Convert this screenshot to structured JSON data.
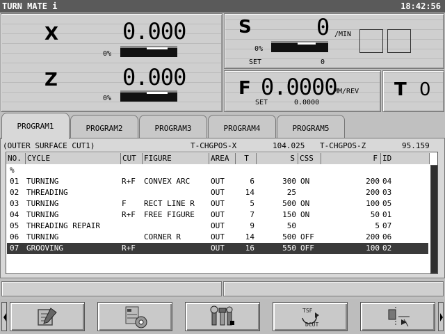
{
  "title_bar": {
    "app_name": "TURN MATE i",
    "clock": "18:42:56"
  },
  "axes": {
    "x": {
      "letter": "X",
      "value": "0.000",
      "percent": "0%"
    },
    "z": {
      "letter": "Z",
      "value": "0.000",
      "percent": "0%"
    }
  },
  "spindle": {
    "letter": "S",
    "value": "0",
    "unit": "/MIN",
    "percent": "0%",
    "set_label": "SET",
    "set_value": "0"
  },
  "feed": {
    "letter": "F",
    "value": "0.0000",
    "unit": "MM/REV",
    "set_label": "SET",
    "set_value": "0.0000"
  },
  "tool": {
    "letter": "T",
    "value": "0"
  },
  "tabs": [
    {
      "label": "PROGRAM1"
    },
    {
      "label": "PROGRAM2"
    },
    {
      "label": "PROGRAM3"
    },
    {
      "label": "PROGRAM4"
    },
    {
      "label": "PROGRAM5"
    }
  ],
  "program_info": {
    "name": "(OUTER SURFACE CUT1)",
    "x_label": "T-CHGPOS-X",
    "x_value": "104.025",
    "z_label": "T-CHGPOS-Z",
    "z_value": "95.159"
  },
  "columns": [
    "NO.",
    "CYCLE",
    "CUT",
    "FIGURE",
    "AREA",
    "T",
    "S",
    "CSS",
    "F",
    "ID"
  ],
  "percent_row": "%",
  "rows": [
    {
      "no": "01",
      "cycle": "TURNING",
      "cut": "R+F",
      "figure": "CONVEX ARC",
      "area": "OUT",
      "t": "6",
      "s": "300",
      "css": "ON",
      "f": "200",
      "id": "04"
    },
    {
      "no": "02",
      "cycle": "THREADING",
      "cut": "",
      "figure": "",
      "area": "OUT",
      "t": "14",
      "s": "25",
      "css": "",
      "f": "200",
      "id": "03"
    },
    {
      "no": "03",
      "cycle": "TURNING",
      "cut": "F",
      "figure": "RECT LINE R",
      "area": "OUT",
      "t": "5",
      "s": "500",
      "css": "ON",
      "f": "100",
      "id": "05"
    },
    {
      "no": "04",
      "cycle": "TURNING",
      "cut": "R+F",
      "figure": "FREE FIGURE",
      "area": "OUT",
      "t": "7",
      "s": "150",
      "css": "ON",
      "f": "50",
      "id": "01"
    },
    {
      "no": "05",
      "cycle": "THREADING REPAIR",
      "cut": "",
      "figure": "",
      "area": "OUT",
      "t": "9",
      "s": "50",
      "css": "",
      "f": "5",
      "id": "07"
    },
    {
      "no": "06",
      "cycle": "TURNING",
      "cut": "",
      "figure": "CORNER R",
      "area": "OUT",
      "t": "14",
      "s": "500",
      "css": "OFF",
      "f": "200",
      "id": "06"
    },
    {
      "no": "07",
      "cycle": "GROOVING",
      "cut": "R+F",
      "figure": "",
      "area": "OUT",
      "t": "16",
      "s": "550",
      "css": "OFF",
      "f": "100",
      "id": "02",
      "selected": true
    }
  ],
  "softkeys": [
    {
      "icon": "edit-icon"
    },
    {
      "icon": "tool-settings-icon"
    },
    {
      "icon": "wrench-icon"
    },
    {
      "icon": "tsf-dcut-icon",
      "top_text": "TSF",
      "bottom_text": "DCUT"
    },
    {
      "icon": "measure-icon"
    }
  ]
}
